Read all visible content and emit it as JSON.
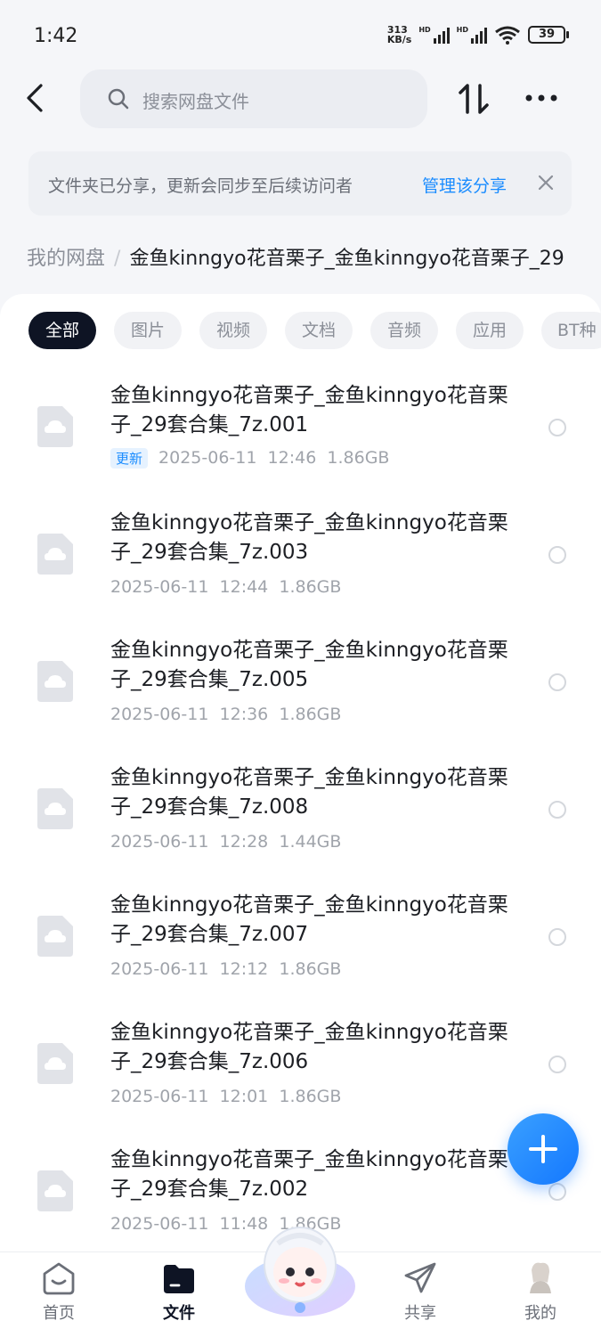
{
  "status_bar": {
    "time": "1:42",
    "speed_value": "313",
    "speed_unit": "KB/s",
    "battery": "39",
    "hd1": "HD",
    "hd2": "HD"
  },
  "header": {
    "search_placeholder": "搜索网盘文件"
  },
  "banner": {
    "text": "文件夹已分享，更新会同步至后续访问者",
    "link": "管理该分享"
  },
  "breadcrumb": {
    "root": "我的网盘",
    "separator": "/",
    "current": "金鱼kinngyo花音栗子_金鱼kinngyo花音栗子_29"
  },
  "filters": [
    "全部",
    "图片",
    "视频",
    "文档",
    "音频",
    "应用",
    "BT种"
  ],
  "files": [
    {
      "name": "金鱼kinngyo花音栗子_金鱼kinngyo花音栗子_29套合集_7z.001",
      "tag": "更新",
      "date": "2025-06-11",
      "time": "12:46",
      "size": "1.86GB"
    },
    {
      "name": "金鱼kinngyo花音栗子_金鱼kinngyo花音栗子_29套合集_7z.003",
      "tag": "",
      "date": "2025-06-11",
      "time": "12:44",
      "size": "1.86GB"
    },
    {
      "name": "金鱼kinngyo花音栗子_金鱼kinngyo花音栗子_29套合集_7z.005",
      "tag": "",
      "date": "2025-06-11",
      "time": "12:36",
      "size": "1.86GB"
    },
    {
      "name": "金鱼kinngyo花音栗子_金鱼kinngyo花音栗子_29套合集_7z.008",
      "tag": "",
      "date": "2025-06-11",
      "time": "12:28",
      "size": "1.44GB"
    },
    {
      "name": "金鱼kinngyo花音栗子_金鱼kinngyo花音栗子_29套合集_7z.007",
      "tag": "",
      "date": "2025-06-11",
      "time": "12:12",
      "size": "1.86GB"
    },
    {
      "name": "金鱼kinngyo花音栗子_金鱼kinngyo花音栗子_29套合集_7z.006",
      "tag": "",
      "date": "2025-06-11",
      "time": "12:01",
      "size": "1.86GB"
    },
    {
      "name": "金鱼kinngyo花音栗子_金鱼kinngyo花音栗子_29套合集_7z.002",
      "tag": "",
      "date": "2025-06-11",
      "time": "11:48",
      "size": "1.86GB"
    }
  ],
  "tabbar": {
    "home": "首页",
    "files": "文件",
    "share": "共享",
    "mine": "我的"
  },
  "colors": {
    "accent": "#1a8cff",
    "chip_active": "#0e1424",
    "meta_text": "#a0a4ab"
  }
}
